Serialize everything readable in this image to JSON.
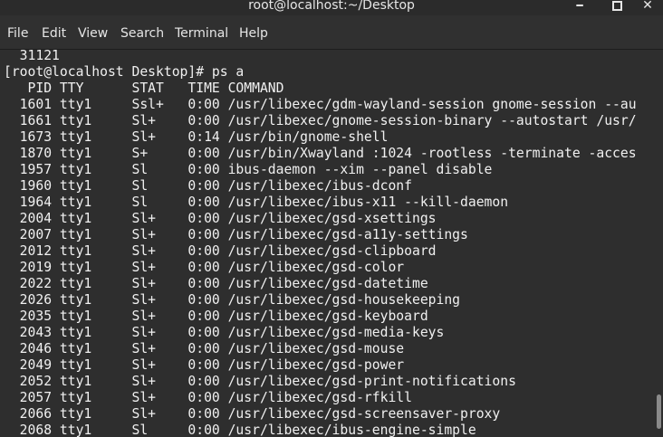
{
  "window": {
    "title": "root@localhost:~/Desktop",
    "minimize_icon": "minimize-icon",
    "maximize_icon": "maximize-icon",
    "close_icon": "close-icon",
    "close_glyph": "✕",
    "minimize_glyph": "━"
  },
  "menu": [
    "File",
    "Edit",
    "View",
    "Search",
    "Terminal",
    "Help"
  ],
  "terminal": {
    "lines": [
      "  31121",
      "[root@localhost Desktop]# ps a",
      "   PID TTY      STAT   TIME COMMAND",
      "  1601 tty1     Ssl+   0:00 /usr/libexec/gdm-wayland-session gnome-session --au",
      "  1661 tty1     Sl+    0:00 /usr/libexec/gnome-session-binary --autostart /usr/",
      "  1673 tty1     Sl+    0:14 /usr/bin/gnome-shell",
      "  1870 tty1     S+     0:00 /usr/bin/Xwayland :1024 -rootless -terminate -acces",
      "  1957 tty1     Sl     0:00 ibus-daemon --xim --panel disable",
      "  1960 tty1     Sl     0:00 /usr/libexec/ibus-dconf",
      "  1964 tty1     Sl     0:00 /usr/libexec/ibus-x11 --kill-daemon",
      "  2004 tty1     Sl+    0:00 /usr/libexec/gsd-xsettings",
      "  2007 tty1     Sl+    0:00 /usr/libexec/gsd-a11y-settings",
      "  2012 tty1     Sl+    0:00 /usr/libexec/gsd-clipboard",
      "  2019 tty1     Sl+    0:00 /usr/libexec/gsd-color",
      "  2022 tty1     Sl+    0:00 /usr/libexec/gsd-datetime",
      "  2026 tty1     Sl+    0:00 /usr/libexec/gsd-housekeeping",
      "  2035 tty1     Sl+    0:00 /usr/libexec/gsd-keyboard",
      "  2043 tty1     Sl+    0:00 /usr/libexec/gsd-media-keys",
      "  2046 tty1     Sl+    0:00 /usr/libexec/gsd-mouse",
      "  2049 tty1     Sl+    0:00 /usr/libexec/gsd-power",
      "  2052 tty1     Sl+    0:00 /usr/libexec/gsd-print-notifications",
      "  2057 tty1     Sl+    0:00 /usr/libexec/gsd-rfkill",
      "  2066 tty1     Sl+    0:00 /usr/libexec/gsd-screensaver-proxy",
      "  2068 tty1     Sl     0:00 /usr/libexec/ibus-engine-simple"
    ]
  },
  "colors": {
    "terminal_bg": "#2e2e2e",
    "text": "#f0f0f0",
    "titlebar_bg": "#2b2b2b",
    "menubar_bg": "#303030"
  }
}
